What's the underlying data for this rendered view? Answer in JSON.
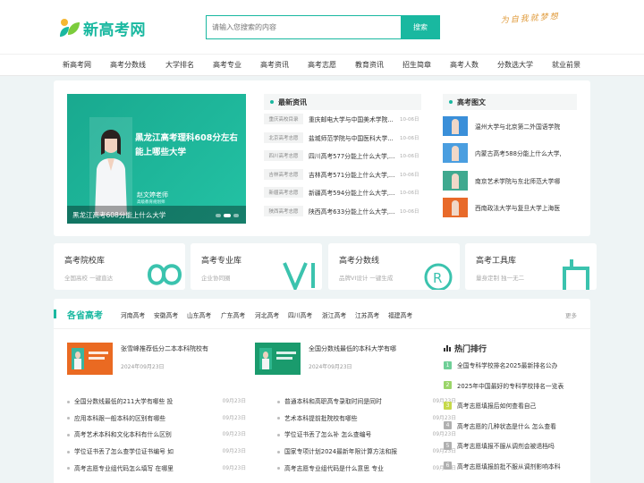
{
  "header": {
    "logo_text": "新高考网",
    "search_placeholder": "请输入您搜索的内容",
    "search_button": "搜索",
    "slogan": "为自我就梦想"
  },
  "nav": [
    "新高考网",
    "高考分数线",
    "大学排名",
    "高考专业",
    "高考资讯",
    "高考志愿",
    "教育资讯",
    "招生简章",
    "高考人数",
    "分数选大学",
    "就业前景"
  ],
  "banner": {
    "title": "黑龙江高考理科608分左右能上哪些大学",
    "teacher_name": "赵文婷老师",
    "teacher_sub": "高级教育规划师",
    "caption": "黑龙江高考608分能上什么大学"
  },
  "news": {
    "heading": "最新资讯",
    "items": [
      {
        "tag": "重庆高校目录",
        "title": "重庆邮电大学与中国美术学院...",
        "date": "10-06日"
      },
      {
        "tag": "北京高考志愿",
        "title": "盐城师范学院与中国医科大学...",
        "date": "10-06日"
      },
      {
        "tag": "四川高考志愿",
        "title": "四川高考577分能上什么大学,...",
        "date": "10-06日"
      },
      {
        "tag": "吉林高考志愿",
        "title": "吉林高考571分能上什么大学,...",
        "date": "10-06日"
      },
      {
        "tag": "新疆高考志愿",
        "title": "新疆高考594分能上什么大学,...",
        "date": "10-06日"
      },
      {
        "tag": "陕西高考志愿",
        "title": "陕西高考633分能上什么大学,...",
        "date": "10-06日"
      }
    ]
  },
  "pics": {
    "heading": "高考图文",
    "items": [
      {
        "title": "温州大学与北京第二外国语学院",
        "color": "#3a8fd9"
      },
      {
        "title": "内蒙古高考588分能上什么大学,",
        "color": "#4a9ee0"
      },
      {
        "title": "南京艺术学院与东北师范大学哪",
        "color": "#3fa98f"
      },
      {
        "title": "西南政法大学与复旦大学上海医",
        "color": "#e86a2a"
      }
    ]
  },
  "libraries": [
    {
      "title": "高考院校库",
      "sub": "全国高校 一键直达"
    },
    {
      "title": "高考专业库",
      "sub": "企业协同圈"
    },
    {
      "title": "高考分数线",
      "sub": "品牌VI设计 一键生成"
    },
    {
      "title": "高考工具库",
      "sub": "量身定制 独一无二"
    }
  ],
  "provinces": {
    "heading": "各省高考",
    "links": [
      "河南高考",
      "安徽高考",
      "山东高考",
      "广东高考",
      "河北高考",
      "四川高考",
      "浙江高考",
      "江苏高考",
      "福建高考"
    ],
    "more": "更多",
    "featured": [
      {
        "title": "张雪峰推荐低分二本本科院校有",
        "date": "2024年09月23日"
      },
      {
        "title": "全国分数线最低的本科大学有哪",
        "date": "2024年09月23日"
      }
    ],
    "list_left": [
      {
        "title": "全国分数线最低的211大学有哪些 投",
        "date": "09月23日"
      },
      {
        "title": "应用本科跟一般本科的区别有哪些",
        "date": "09月23日"
      },
      {
        "title": "高考艺术本科和文化本科有什么区别",
        "date": "09月23日"
      },
      {
        "title": "学位证书丢了怎么查学位证书编号 如",
        "date": "09月23日"
      },
      {
        "title": "高考志愿专业组代码怎么填写 在哪里",
        "date": "09月23日"
      }
    ],
    "list_right": [
      {
        "title": "普通本科和高职高专录取时间是同时",
        "date": "09月23日"
      },
      {
        "title": "艺术本科提前批院校有哪些",
        "date": "09月23日"
      },
      {
        "title": "学位证书丢了怎么补 怎么查编号",
        "date": "09月23日"
      },
      {
        "title": "国家专项计划2024最新年限计算方法和报",
        "date": "09月23日"
      },
      {
        "title": "高考志愿专业组代码是什么意思 专业",
        "date": "09月23日"
      }
    ]
  },
  "ranking": {
    "heading": "热门排行",
    "items": [
      {
        "num": "1",
        "title": "全国专科学校排名2025最新排名公办",
        "color": "#6fcf97"
      },
      {
        "num": "2",
        "title": "2025年中国最好的专科学校排名一览表",
        "color": "#9bd56a"
      },
      {
        "num": "3",
        "title": "高考志愿填报后如何查看自己",
        "color": "#c6d94a"
      },
      {
        "num": "4",
        "title": "高考志愿的几种状态是什么 怎么查看",
        "color": "#b0b0b0"
      },
      {
        "num": "5",
        "title": "高考志愿填报不服从调剂会被退档吗",
        "color": "#b0b0b0"
      },
      {
        "num": "6",
        "title": "高考志愿填报前批不服从调剂影响本科",
        "color": "#b0b0b0"
      }
    ]
  }
}
